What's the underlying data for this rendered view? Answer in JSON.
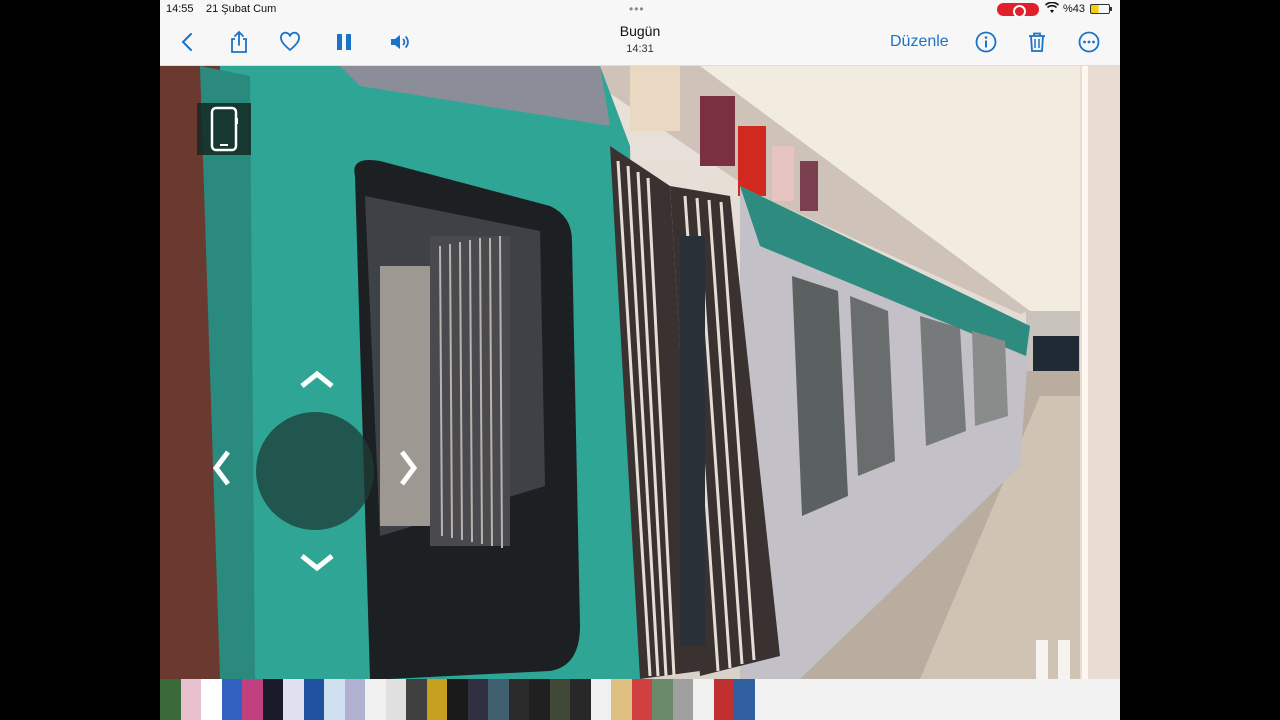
{
  "statusbar": {
    "time": "14:55",
    "date": "21 Şubat Cum",
    "battery": "%43",
    "icons": [
      "screen-record-icon",
      "wifi-icon",
      "battery-icon"
    ]
  },
  "toolbar": {
    "title": "Bugün",
    "subtitle": "14:31",
    "edit_label": "Düzenle",
    "accent_color": "#1a73c7",
    "icons": [
      "back-icon",
      "share-icon",
      "heart-icon",
      "pause-icon",
      "volume-icon",
      "info-icon",
      "trash-icon",
      "more-icon"
    ]
  },
  "video": {
    "overlay_icons": [
      "phone-icon",
      "joystick-up-icon",
      "joystick-down-icon",
      "joystick-left-icon",
      "joystick-right-icon",
      "pause-overlay-icon"
    ]
  },
  "filmstrip": {
    "thumb_colors": [
      "#3a6a3a",
      "#e8c0d0",
      "#ffffff",
      "#3060c0",
      "#c04080",
      "#1a1a2a",
      "#e0e0f0",
      "#2050a0",
      "#d0e0f0",
      "#b0b0d0",
      "#f0f0f0",
      "#e0e0e0",
      "#404040",
      "#c8a020",
      "#1a1a1a",
      "#303040",
      "#406070",
      "#2a2a2a",
      "#202020",
      "#404838",
      "#282828",
      "#f0f0f0",
      "#e0c080",
      "#d04040",
      "#6a8a6a",
      "#a0a0a0",
      "#f0f0f0",
      "#c03030",
      "#3060a0"
    ]
  }
}
